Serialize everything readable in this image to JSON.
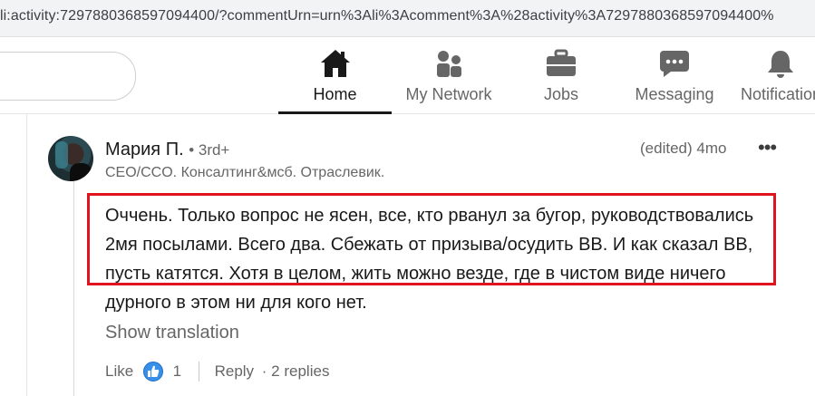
{
  "browser": {
    "url": "li:activity:7297880368597094400/?commentUrn=urn%3Ali%3Acomment%3A%28activity%3A7297880368597094400%"
  },
  "nav": {
    "items": [
      {
        "label": "Home",
        "icon": "home-icon",
        "active": true
      },
      {
        "label": "My Network",
        "icon": "network-icon",
        "active": false
      },
      {
        "label": "Jobs",
        "icon": "briefcase-icon",
        "active": false
      },
      {
        "label": "Messaging",
        "icon": "messaging-icon",
        "active": false
      },
      {
        "label": "Notifications",
        "icon": "bell-icon",
        "active": false
      }
    ]
  },
  "comment": {
    "author_name": "Мария П.",
    "degree": "• 3rd+",
    "headline": "CEO/CCO. Консалтинг&мсб. Отраслевик.",
    "meta": "(edited) 4mo",
    "more_label": "•••",
    "text": "Оччень. Только вопрос не ясен, все, кто рванул за бугор, руководствовались 2мя посылами. Всего два. Сбежать от призыва/осудить ВВ. И как сказал ВВ, пусть катятся. Хотя в целом, жить можно везде, где в чистом виде ничего дурного в этом ни для кого нет.",
    "show_translation": "Show translation",
    "like_label": "Like",
    "like_count": "1",
    "reply_label": "Reply",
    "replies": "· 2 replies"
  },
  "colors": {
    "highlight_box": "#e0141e",
    "like_blue": "#378fe9",
    "active_nav": "#191919",
    "muted_text": "#666666"
  }
}
